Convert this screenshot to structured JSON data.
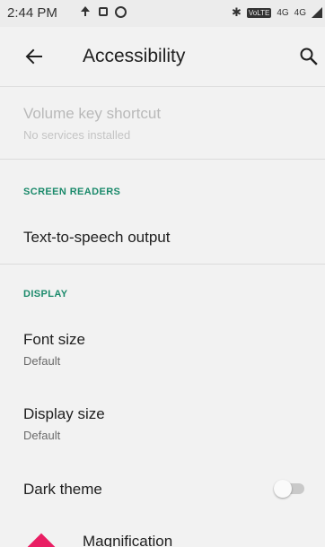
{
  "status_bar": {
    "time": "2:44 PM",
    "volte": "VoLTE",
    "network": "4G",
    "network2": "4G"
  },
  "app_bar": {
    "title": "Accessibility",
    "back_icon": "arrow-back-icon",
    "search_icon": "search-icon"
  },
  "items": {
    "volume_key_shortcut": {
      "title": "Volume key shortcut",
      "summary": "No services installed",
      "enabled": false
    },
    "screen_readers_header": "SCREEN READERS",
    "tts_output": {
      "title": "Text-to-speech output"
    },
    "display_header": "DISPLAY",
    "font_size": {
      "title": "Font size",
      "summary": "Default"
    },
    "display_size": {
      "title": "Display size",
      "summary": "Default"
    },
    "dark_theme": {
      "title": "Dark theme",
      "toggle_on": false
    },
    "magnification": {
      "title": "Magnification",
      "icon": "magnification-icon"
    }
  },
  "colors": {
    "accent": "#1b8a6b",
    "magnification_icon": "#e91e63",
    "background": "#f2f2f2"
  }
}
